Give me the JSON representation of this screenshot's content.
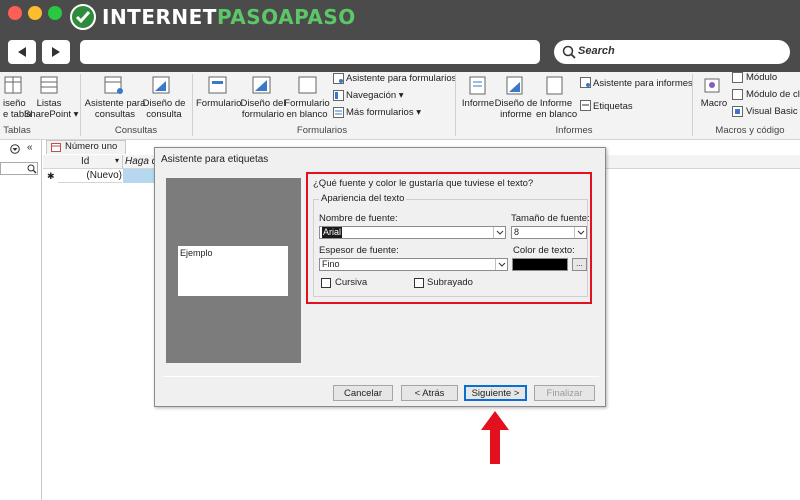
{
  "browser": {
    "logo_prefix": "INTERNET",
    "logo_accent": "PASOAPASO",
    "search_placeholder": "Search"
  },
  "ribbon": {
    "tables": {
      "item1": "iseño",
      "item1b": "e tabla",
      "item2": "Listas",
      "item2b": "SharePoint ▾",
      "group": "Tablas"
    },
    "queries": {
      "item1": "Asistente para",
      "item1b": "consultas",
      "item2": "Diseño de",
      "item2b": "consulta",
      "group": "Consultas"
    },
    "forms": {
      "item1": "Formulario",
      "item2": "Diseño del",
      "item2b": "formulario",
      "item3": "Formulario",
      "item3b": "en blanco",
      "wizard": "Asistente para formularios",
      "navigation": "Navegación ▾",
      "more": "Más formularios ▾",
      "group": "Formularios"
    },
    "reports": {
      "item1": "Informe",
      "item2": "Diseño de",
      "item2b": "informe",
      "item3": "Informe",
      "item3b": "en blanco",
      "wizard": "Asistente para informes",
      "labels": "Etiquetas",
      "group": "Informes"
    },
    "macros": {
      "item1": "Macro",
      "module": "Módulo",
      "class_module": "Módulo de cla",
      "vb": "Visual Basic",
      "group": "Macros y código"
    }
  },
  "workspace": {
    "tab_label": "Número uno",
    "col_id": "Id",
    "col_add": "Haga c",
    "new_row_marker": "✱",
    "new_row_value": "(Nuevo)"
  },
  "dialog": {
    "title": "Asistente para etiquetas",
    "preview_text": "Ejemplo",
    "question": "¿Qué fuente y color le gustaría que tuviese el texto?",
    "group_title": "Apariencia del texto",
    "font_name_label": "Nombre de fuente:",
    "font_name_value": "Arial",
    "font_size_label": "Tamaño de fuente:",
    "font_size_value": "8",
    "font_weight_label": "Espesor de fuente:",
    "font_weight_value": "Fino",
    "font_color_label": "Color de texto:",
    "font_color_value": "#000000",
    "color_button": "...",
    "italic_label": "Cursiva",
    "underline_label": "Subrayado",
    "btn_cancel": "Cancelar",
    "btn_back": "< Atrás",
    "btn_next": "Siguiente >",
    "btn_finish": "Finalizar"
  },
  "colors": {
    "highlight": "#e3101e",
    "accent_green": "#2e8b3c",
    "primary_border": "#0b6fd0"
  }
}
